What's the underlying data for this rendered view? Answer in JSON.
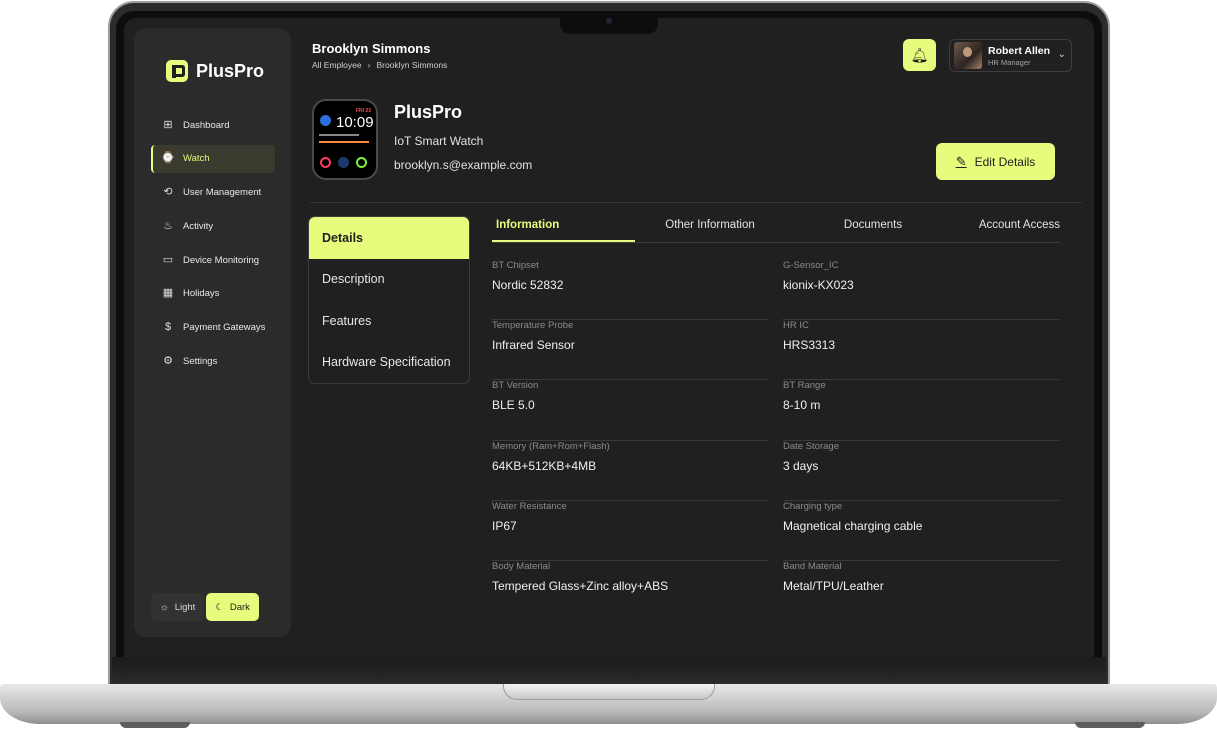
{
  "app": {
    "name": "PlusPro"
  },
  "sidebar": {
    "items": [
      {
        "label": "Dashboard",
        "icon": "dashboard-grid-icon",
        "glyph": "⊞"
      },
      {
        "label": "Watch",
        "icon": "watch-icon",
        "glyph": "⌚"
      },
      {
        "label": "User Management",
        "icon": "user-management-icon",
        "glyph": "⟲"
      },
      {
        "label": "Activity",
        "icon": "activity-run-icon",
        "glyph": "♨"
      },
      {
        "label": "Device Monitoring",
        "icon": "monitor-icon",
        "glyph": "▭"
      },
      {
        "label": "Holidays",
        "icon": "calendar-icon",
        "glyph": "▦"
      },
      {
        "label": "Payment Gateways",
        "icon": "dollar-icon",
        "glyph": "$"
      },
      {
        "label": "Settings",
        "icon": "gear-icon",
        "glyph": "⚙"
      }
    ],
    "active_item": "Watch",
    "theme": {
      "light_label": "Light",
      "dark_label": "Dark",
      "selected": "Dark"
    }
  },
  "header": {
    "title": "Brooklyn Simmons",
    "breadcrumb": [
      "All Employee",
      "Brooklyn Simmons"
    ],
    "breadcrumb_separator": "›",
    "user": {
      "name": "Robert Allen",
      "role": "HR Manager"
    }
  },
  "product": {
    "name": "PlusPro",
    "type": "IoT Smart Watch",
    "email": "brooklyn.s@example.com",
    "watch_face": {
      "time": "10:09",
      "date": "FRI 23"
    },
    "edit_label": "Edit Details"
  },
  "left_tabs": [
    "Details",
    "Description",
    "Features",
    "Hardware Specification"
  ],
  "top_tabs": [
    "Information",
    "Other Information",
    "Documents",
    "Account Access"
  ],
  "information": [
    {
      "label": "BT Chipset",
      "value": "Nordic 52832"
    },
    {
      "label": "G-Sensor_IC",
      "value": "kionix-KX023"
    },
    {
      "label": "Temperature Probe",
      "value": "Infrared Sensor"
    },
    {
      "label": "HR IC",
      "value": "HRS3313"
    },
    {
      "label": "BT Version",
      "value": "BLE 5.0"
    },
    {
      "label": "BT Range",
      "value": "8-10 m"
    },
    {
      "label": "Memory (Ram+Rom+Flash)",
      "value": "64KB+512KB+4MB"
    },
    {
      "label": "Date Storage",
      "value": "3 days"
    },
    {
      "label": "Water Resistance",
      "value": "IP67"
    },
    {
      "label": "Charging type",
      "value": "Magnetical charging cable"
    },
    {
      "label": "Body Material",
      "value": "Tempered Glass+Zinc alloy+ABS"
    },
    {
      "label": "Band Material",
      "value": "Metal/TPU/Leather"
    }
  ],
  "colors": {
    "accent": "#e8fb7d",
    "background": "#202020",
    "panel": "#2b2b2b"
  }
}
